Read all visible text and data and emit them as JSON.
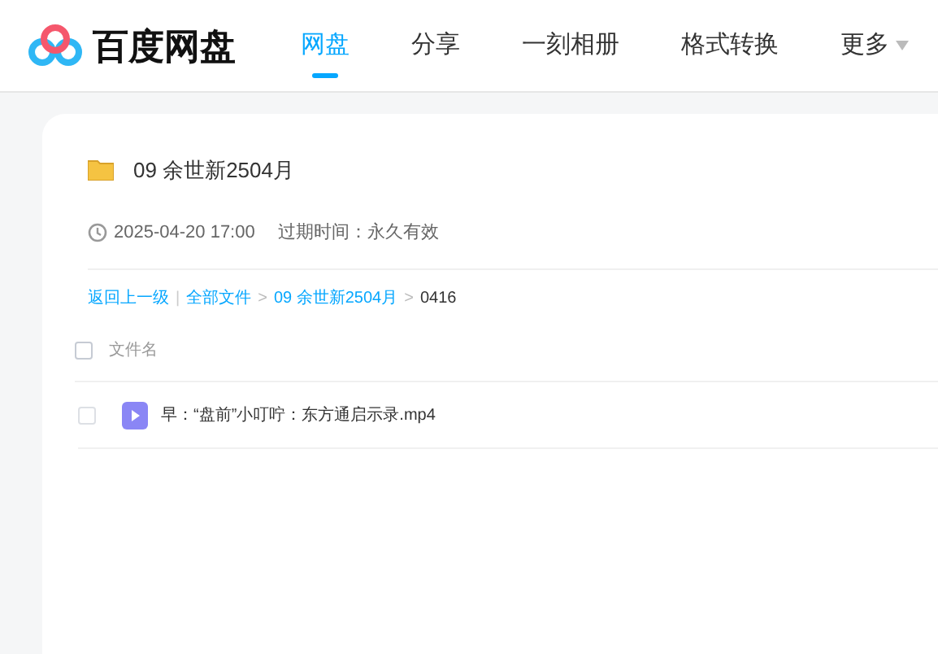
{
  "logo": {
    "text": "百度网盘"
  },
  "nav": [
    {
      "label": "网盘",
      "selected": true
    },
    {
      "label": "分享",
      "selected": false
    },
    {
      "label": "一刻相册",
      "selected": false
    },
    {
      "label": "格式转换",
      "selected": false
    },
    {
      "label": "更多",
      "selected": false
    }
  ],
  "share": {
    "title": "09 余世新2504月",
    "time": "2025-04-20 17:00",
    "expiry": "过期时间：永久有效"
  },
  "breadcrumb": {
    "back": "返回上一级",
    "divider": "|",
    "items": [
      {
        "label": "全部文件",
        "link": true
      },
      {
        "label": "09 余世新2504月",
        "link": true
      },
      {
        "label": "0416",
        "link": false
      }
    ],
    "separator": ">"
  },
  "table": {
    "column": "文件名",
    "select_all": {
      "checked": false
    },
    "rows": [
      {
        "name": "早：“盘前”小叮咛：东方通启示录.mp4",
        "checked": false,
        "kind": "video"
      }
    ]
  }
}
